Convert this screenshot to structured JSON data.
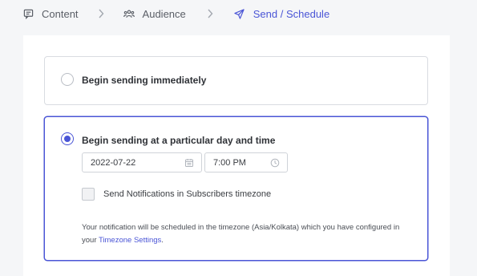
{
  "steps": [
    {
      "label": "Content",
      "icon": "message-square-icon"
    },
    {
      "label": "Audience",
      "icon": "users-icon"
    },
    {
      "label": "Send / Schedule",
      "icon": "send-icon"
    }
  ],
  "options": {
    "immediate": {
      "label": "Begin sending immediately",
      "selected": false
    },
    "scheduled": {
      "label": "Begin sending at a particular day and time",
      "selected": true,
      "date": "2022-07-22",
      "time": "7:00 PM",
      "subscriber_timezone": {
        "label": "Send Notifications in Subscribers timezone",
        "checked": false
      },
      "note_text": "Your notification will be scheduled in the timezone (Asia/Kolkata) which you have configured in your",
      "note_link": "Timezone Settings",
      "note_end": "."
    }
  },
  "colors": {
    "accent": "#4a55d6",
    "background": "#f5f6f8",
    "border": "#d9dce1"
  }
}
